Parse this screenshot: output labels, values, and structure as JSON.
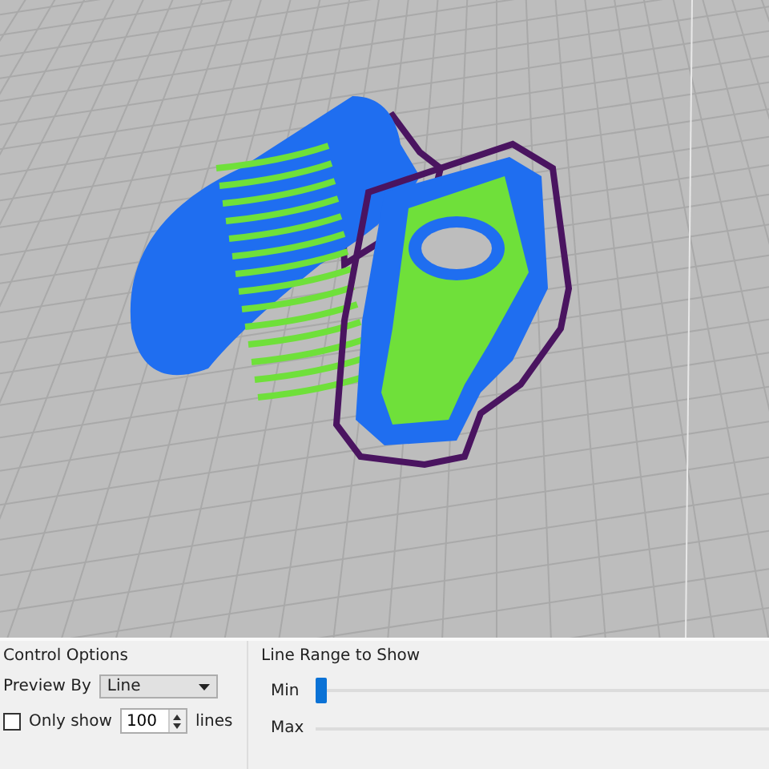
{
  "viewport": {
    "kind": "preview"
  },
  "control_options": {
    "title": "Control Options",
    "preview_by": {
      "label": "Preview By",
      "value": "Line"
    },
    "only_show": {
      "label": "Only show",
      "checked": false,
      "value": "100",
      "unit": "lines"
    }
  },
  "line_range": {
    "title": "Line Range to Show",
    "sliders": [
      {
        "label": "Min",
        "level": 0
      },
      {
        "label": "Max"
      }
    ]
  }
}
